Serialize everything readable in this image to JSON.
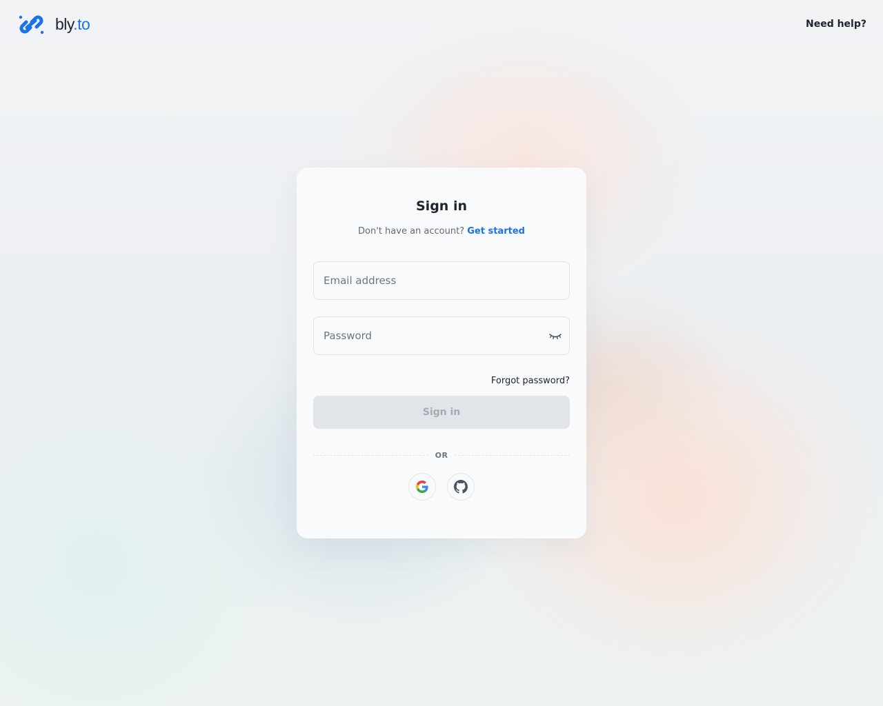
{
  "header": {
    "logo_text": "bly",
    "logo_tld": ".to",
    "help_label": "Need help?"
  },
  "card": {
    "title": "Sign in",
    "subtitle_text": "Don't have an account? ",
    "get_started_label": "Get started",
    "email_placeholder": "Email address",
    "email_value": "",
    "password_placeholder": "Password",
    "password_value": "",
    "forgot_label": "Forgot password?",
    "signin_label": "Sign in",
    "signin_enabled": false,
    "divider_label": "OR",
    "social_providers": [
      "google-icon",
      "github-icon"
    ]
  },
  "colors": {
    "accent": "#1a73e8",
    "text": "#1c2430",
    "muted": "#5f6b78",
    "disabled_button_bg": "#e1e4e8",
    "disabled_button_text": "#a3abb4"
  },
  "icons": {
    "logo": "chain-link-icon",
    "password_toggle": "eye-closed-icon"
  }
}
